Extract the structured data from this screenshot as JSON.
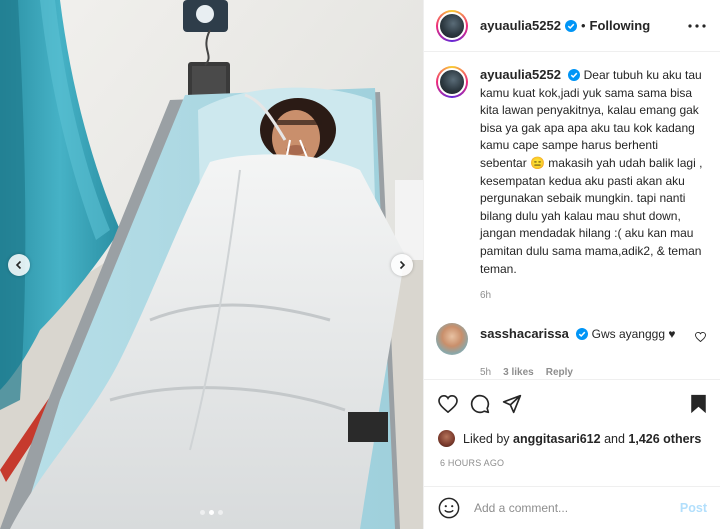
{
  "post": {
    "author": "ayuaulia5252",
    "separator": "•",
    "follow_status": "Following",
    "caption": "Dear tubuh ku aku tau kamu kuat kok,jadi yuk sama sama bisa kita lawan penyakitnya, kalau emang gak bisa ya gak apa apa aku tau kok kadang kamu cape sampe harus berhenti sebentar 😑 makasih yah udah balik lagi , kesempatan kedua aku pasti akan aku pergunakan sebaik mungkin. tapi nanti bilang dulu yah kalau mau shut down, jangan mendadak hilang :( aku kan mau pamitan dulu sama mama,adik2, & teman teman.",
    "caption_age": "6h"
  },
  "comments": [
    {
      "user": "sasshacarissa",
      "text": "Gws ayanggg ♥",
      "age": "5h",
      "likes": "3 likes",
      "reply": "Reply"
    }
  ],
  "likes": {
    "prefix": "Liked by",
    "user": "anggitasari612",
    "joiner": "and",
    "others": "1,426 others"
  },
  "timestamp": "6 HOURS AGO",
  "comment_box": {
    "placeholder": "Add a comment...",
    "post_label": "Post"
  },
  "carousel": {
    "total_slides": 3,
    "active_slide": 2
  },
  "colors": {
    "verified": "#0095f6",
    "post_disabled": "#b2dffc",
    "secondary_text": "#8e8e8e"
  },
  "icons": [
    "more-icon",
    "verified-icon",
    "heart-icon",
    "comment-icon",
    "share-icon",
    "save-icon",
    "emoji-icon",
    "chevron-left-icon",
    "chevron-right-icon"
  ]
}
